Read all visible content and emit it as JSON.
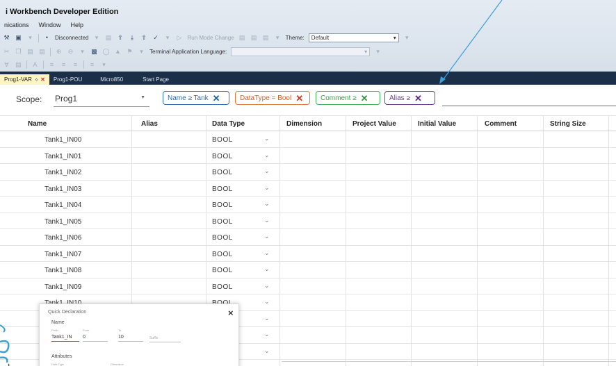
{
  "app": {
    "title": "i Workbench Developer Edition"
  },
  "menu": [
    "nications",
    "Window",
    "Help"
  ],
  "toolbar": {
    "connection": "Disconnected",
    "run_mode_change": "Run Mode Change",
    "theme_label": "Theme:",
    "theme_value": "Default",
    "terminal_language_label": "Terminal Application Language:",
    "terminal_language_value": ""
  },
  "doc_tabs": [
    {
      "label": "Prog1-VAR",
      "active": true
    },
    {
      "label": "Prog1-POU",
      "active": false
    },
    {
      "label": "Micro850",
      "active": false
    },
    {
      "label": "Start Page",
      "active": false
    }
  ],
  "scope": {
    "label": "Scope:",
    "value": "Prog1"
  },
  "filters": [
    {
      "text": "Name ≥ Tank",
      "color": "#2e6fb0"
    },
    {
      "text": "DataType = Bool",
      "color": "#e07a3a"
    },
    {
      "text": "Comment ≥",
      "color": "#3cae55"
    },
    {
      "text": "Alias ≥",
      "color": "#6a3d92"
    }
  ],
  "grid": {
    "columns": [
      "Name",
      "Alias",
      "Data Type",
      "Dimension",
      "Project Value",
      "Initial Value",
      "Comment",
      "String Size"
    ],
    "rows": [
      {
        "name": "Tank1_IN00",
        "type": "BOOL"
      },
      {
        "name": "Tank1_IN01",
        "type": "BOOL"
      },
      {
        "name": "Tank1_IN02",
        "type": "BOOL"
      },
      {
        "name": "Tank1_IN03",
        "type": "BOOL"
      },
      {
        "name": "Tank1_IN04",
        "type": "BOOL"
      },
      {
        "name": "Tank1_IN05",
        "type": "BOOL"
      },
      {
        "name": "Tank1_IN06",
        "type": "BOOL"
      },
      {
        "name": "Tank1_IN07",
        "type": "BOOL"
      },
      {
        "name": "Tank1_IN08",
        "type": "BOOL"
      },
      {
        "name": "Tank1_IN09",
        "type": "BOOL"
      },
      {
        "name": "Tank1_IN10",
        "type": "BOOL"
      },
      {
        "name": "",
        "type": ""
      },
      {
        "name": "",
        "type": ""
      },
      {
        "name": "",
        "type": ""
      }
    ]
  },
  "add_button": "+",
  "quick_declaration": {
    "title": "Quick Declaration",
    "name_heading": "Name",
    "prefix_label": "Prefix",
    "prefix_value": "Tank1_IN",
    "from_label": "From",
    "from_value": "0",
    "to_label": "To",
    "to_value": "10",
    "suffix_label": "Suffix",
    "attributes_heading": "Attributes",
    "data_type_label": "Data Type",
    "dimension_label": "Dimension",
    "close": "×"
  },
  "colors": {
    "tab_strip": "#1b2f48",
    "active_tab": "#fff4c2",
    "arrow": "#3a9fd6"
  }
}
